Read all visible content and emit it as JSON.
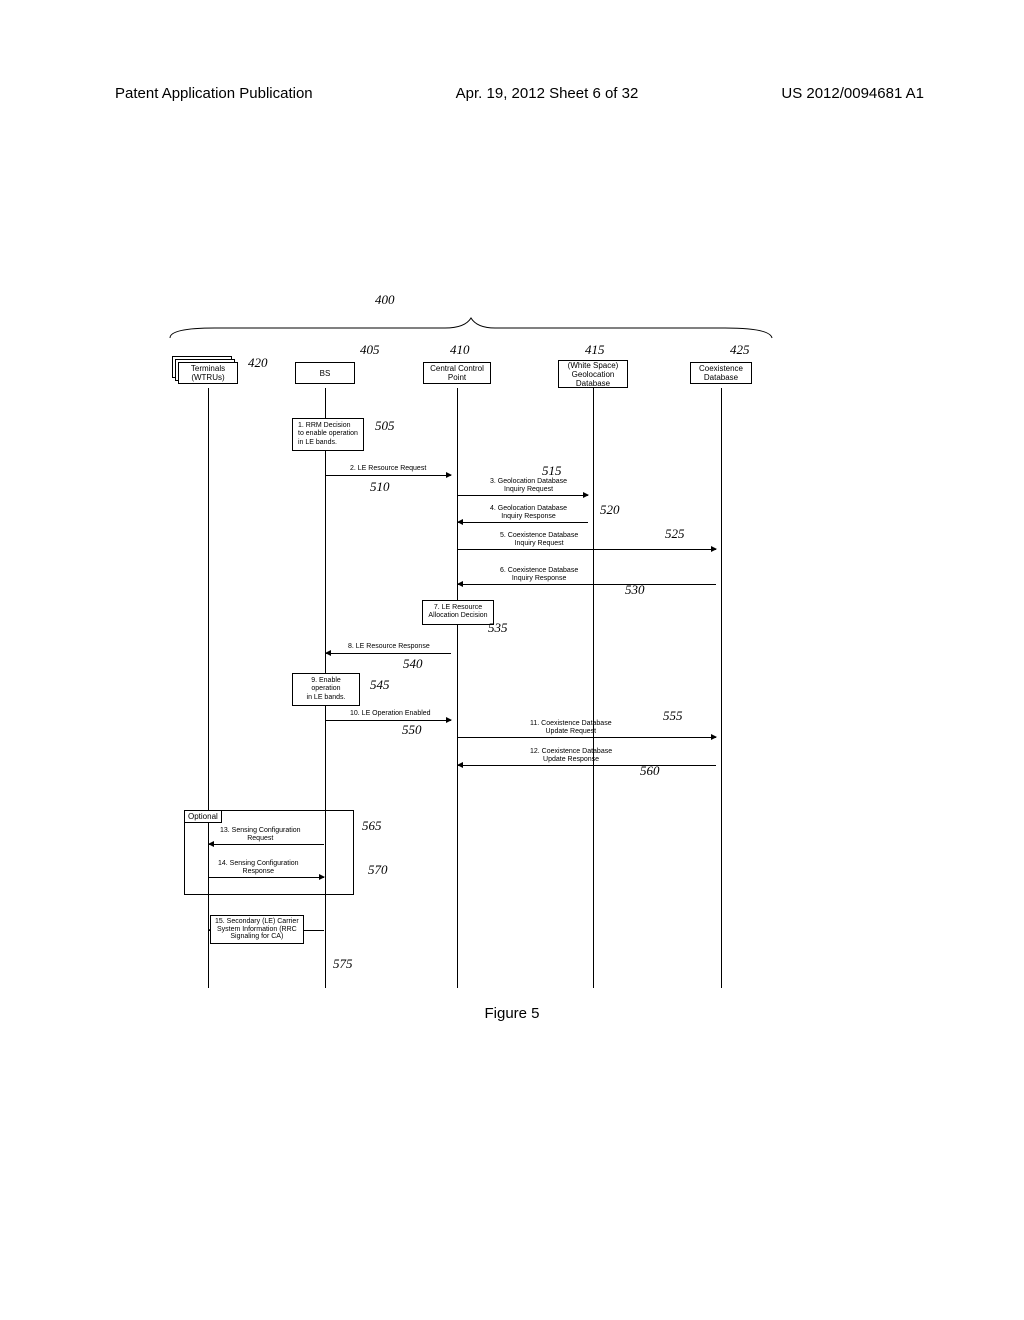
{
  "header": {
    "left": "Patent Application Publication",
    "center": "Apr. 19, 2012  Sheet 6 of 32",
    "right": "US 2012/0094681 A1"
  },
  "system_ref": "400",
  "figure_label": "Figure 5",
  "actors": {
    "terminals": {
      "line1": "Terminals",
      "line2": "(WTRUs)",
      "ref": "420"
    },
    "bs": {
      "label": "BS",
      "ref": "405"
    },
    "ccp": {
      "line1": "Central Control",
      "line2": "Point",
      "ref": "410"
    },
    "geodb": {
      "line1": "(White Space)",
      "line2": "Geolocation",
      "line3": "Database",
      "ref": "415"
    },
    "coexdb": {
      "line1": "Coexistence",
      "line2": "Database",
      "ref": "425"
    }
  },
  "messages": {
    "m1": {
      "text": "1. RRM Decision to enable operation in LE bands.",
      "ref": "505"
    },
    "m2": {
      "text": "2. LE Resource Request",
      "ref": "510"
    },
    "m3": {
      "line1": "3. Geolocation Database",
      "line2": "Inquiry Request",
      "ref": "515"
    },
    "m4": {
      "line1": "4. Geolocation Database",
      "line2": "Inquiry Response",
      "ref": "520"
    },
    "m5": {
      "line1": "5. Coexistence Database",
      "line2": "Inquiry Request",
      "ref": "525"
    },
    "m6": {
      "line1": "6. Coexistence Database",
      "line2": "Inquiry Response",
      "ref": "530"
    },
    "m7": {
      "line1": "7. LE Resource",
      "line2": "Allocation Decision",
      "ref": "535"
    },
    "m8": {
      "text": "8. LE Resource Response",
      "ref": "540"
    },
    "m9": {
      "line1": "9. Enable operation",
      "line2": "in LE bands.",
      "ref": "545"
    },
    "m10": {
      "text": "10. LE Operation Enabled",
      "ref": "550"
    },
    "m11": {
      "line1": "11. Coexistence Database",
      "line2": "Update Request",
      "ref": "555"
    },
    "m12": {
      "line1": "12. Coexistence Database",
      "line2": "Update Response",
      "ref": "560"
    },
    "m13": {
      "line1": "13. Sensing Configuration",
      "line2": "Request",
      "ref": "565"
    },
    "m14": {
      "line1": "14. Sensing Configuration",
      "line2": "Response",
      "ref": "570"
    },
    "m15": {
      "line1": "15. Secondary (LE) Carrier",
      "line2": "System Information (RRC",
      "line3": "Signaling for CA)",
      "ref": "575"
    }
  },
  "optional_label": "Optional"
}
